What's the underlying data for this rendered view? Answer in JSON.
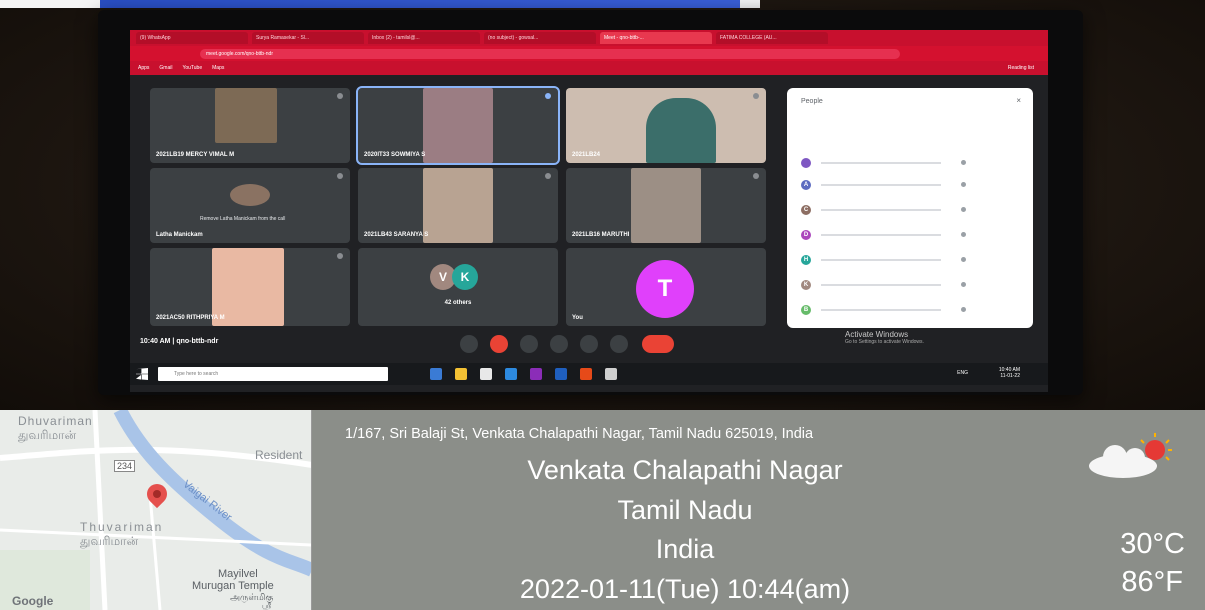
{
  "screen": {
    "tabs": [
      "(9) WhatsApp",
      "Surya Ramasekar - Sl...",
      "Inbox (2) - tamilsl@...",
      "(no subject) - gowsal...",
      "Meet - qno-bttb-...",
      "FATIMA COLLEGE (AU..."
    ],
    "address": "meet.google.com/qno-bttb-ndr",
    "bookmarks": [
      "Apps",
      "Gmail",
      "YouTube",
      "Maps",
      "Reading list"
    ],
    "tiles": [
      {
        "name": "2021LB19 MERCY VIMAL M"
      },
      {
        "name": "2020IT33 SOWMIYA S"
      },
      {
        "name": "2021LB24"
      },
      {
        "name": "Latha Manickam",
        "hover_text": "Remove Latha Manickam from the call"
      },
      {
        "name": "2021LB43 SARANYA S"
      },
      {
        "name": "2021LB16 MARUTHI"
      },
      {
        "name": "2021AC50 RITHPRIYA M"
      },
      {
        "name": "42 others",
        "avatars": [
          "V",
          "K"
        ]
      },
      {
        "name": "You",
        "avatar": "T"
      }
    ],
    "people_panel": {
      "title": "People",
      "close": "×",
      "row_letters": [
        "",
        "A",
        "C",
        "D",
        "H",
        "K",
        "B"
      ]
    },
    "meeting_time": "10:40 AM  |  qno-bttb-ndr",
    "activate": {
      "title": "Activate Windows",
      "sub": "Go to Settings to activate Windows."
    },
    "taskbar": {
      "search_placeholder": "Type here to search",
      "tray_time": "10:40 AM",
      "tray_date": "11-01-22",
      "lang": "ENG"
    }
  },
  "info": {
    "address": "1/167, Sri Balaji St, Venkata Chalapathi Nagar, Tamil Nadu 625019, India",
    "city": "Venkata Chalapathi Nagar",
    "state": "Tamil Nadu",
    "country": "India",
    "datetime": "2022-01-11(Tue)   10:44(am)",
    "temp_c": "30°C",
    "temp_f": "86°F",
    "weather_icon": "partly-cloudy-icon"
  },
  "map": {
    "labels": [
      "Dhuvariman",
      "துவரிமான்",
      "Resident",
      "234",
      "Vaigai River",
      "Thuvariman",
      "துவரிமான்",
      "Mayilvel",
      "Murugan Temple",
      "அருள்மிகு",
      "ஸ்ரீ"
    ],
    "attribution": "Google"
  },
  "colors": {
    "chrome_red": "#c8102e",
    "tile_bg": "#3c4043",
    "end_call": "#ea4335",
    "info_bg": "#8b8e89"
  }
}
